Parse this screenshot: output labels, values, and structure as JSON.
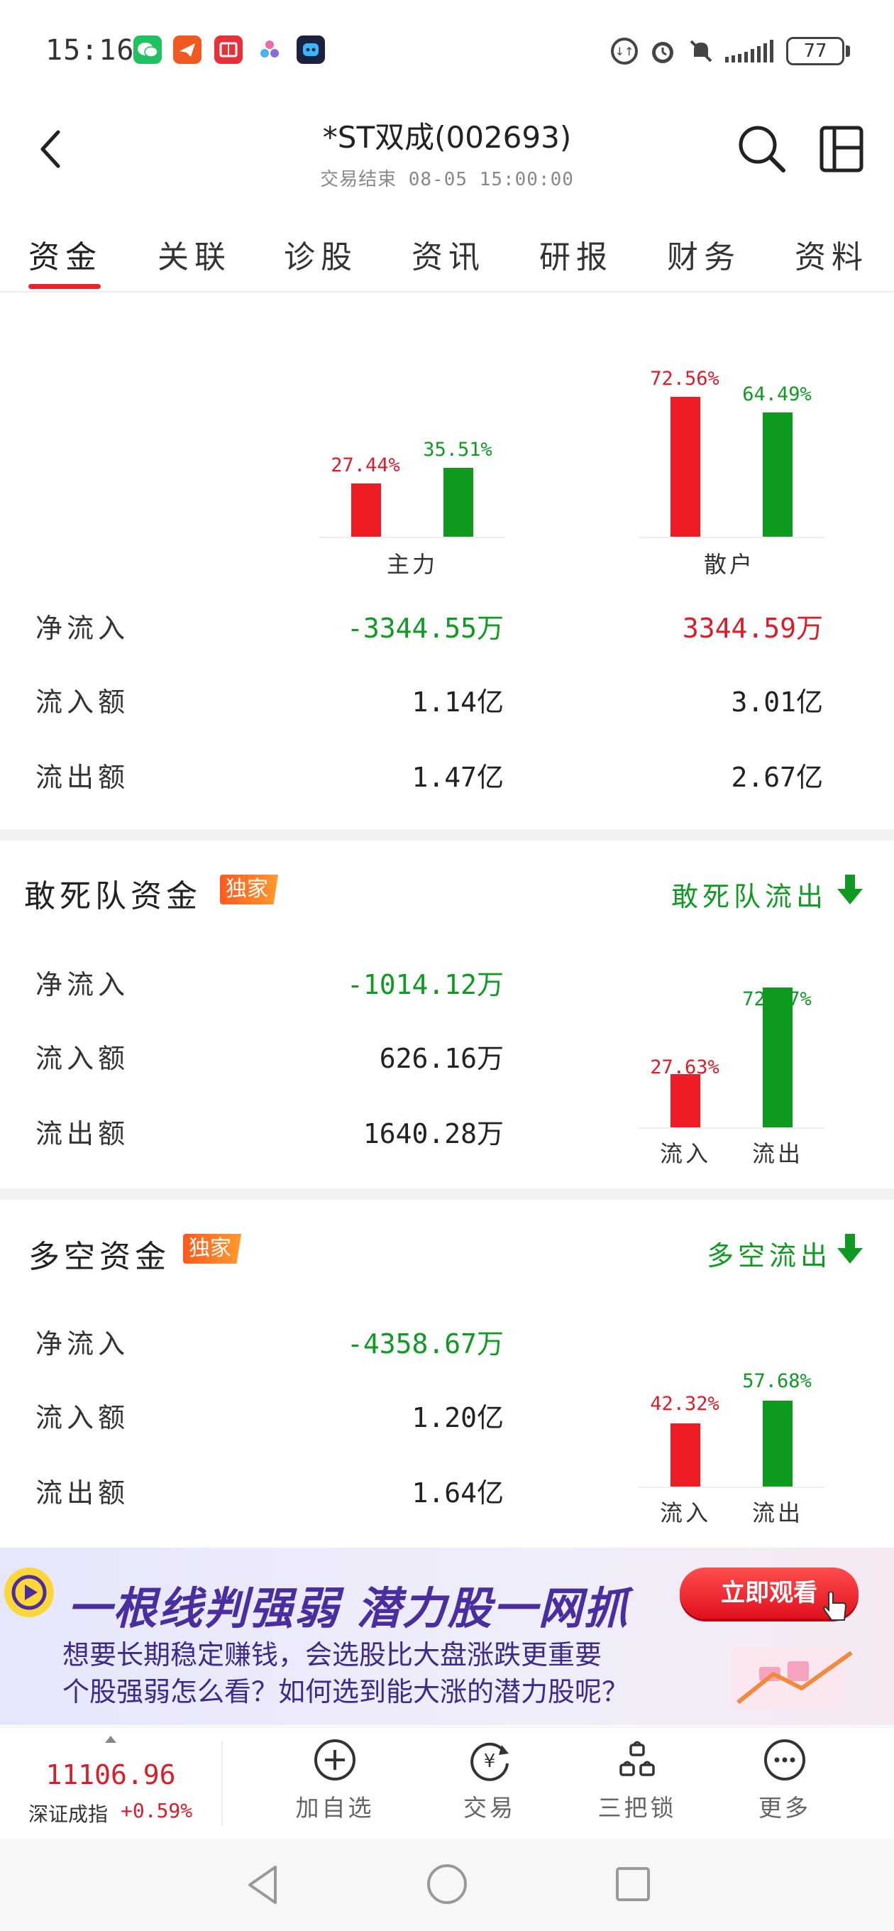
{
  "status_bar": {
    "time": "15:16",
    "battery": "77",
    "apps": [
      "wechat-icon",
      "telegram-like-icon",
      "reader-icon",
      "molecule-icon",
      "robot-icon"
    ],
    "system_icons": [
      "data-saver-icon",
      "alarm-icon",
      "mute-icon",
      "signal-icon"
    ]
  },
  "header": {
    "title": "*ST双成(002693)",
    "subtitle": "交易结束 08-05 15:00:00",
    "back_icon": "back-arrow-icon",
    "search_icon": "search-icon",
    "layout_icon": "layout-icon"
  },
  "tabs": [
    {
      "label": "资金",
      "active": true
    },
    {
      "label": "关联"
    },
    {
      "label": "诊股"
    },
    {
      "label": "资讯"
    },
    {
      "label": "研报"
    },
    {
      "label": "财务"
    },
    {
      "label": "资料"
    }
  ],
  "overview": {
    "groups": [
      {
        "name": "主力",
        "inflow_pct": "27.44%",
        "outflow_pct": "35.51%",
        "inflow_value": 27.44,
        "outflow_value": 35.51
      },
      {
        "name": "散户",
        "inflow_pct": "72.56%",
        "outflow_pct": "64.49%",
        "inflow_value": 72.56,
        "outflow_value": 64.49
      }
    ],
    "rows": [
      {
        "label": "净流入",
        "main": "-3344.55万",
        "retail": "3344.59万"
      },
      {
        "label": "流入额",
        "main": "1.14亿",
        "retail": "3.01亿"
      },
      {
        "label": "流出额",
        "main": "1.47亿",
        "retail": "2.67亿"
      }
    ]
  },
  "dare_to_die": {
    "title": "敢死队资金",
    "badge": "独家",
    "link": "敢死队流出",
    "rows": [
      {
        "label": "净流入",
        "value": "-1014.12万"
      },
      {
        "label": "流入额",
        "value": "626.16万"
      },
      {
        "label": "流出额",
        "value": "1640.28万"
      }
    ],
    "inflow_pct": "27.63%",
    "outflow_pct": "72.37%",
    "inflow_value": 27.63,
    "outflow_value": 72.37,
    "axis_in": "流入",
    "axis_out": "流出"
  },
  "long_short": {
    "title": "多空资金",
    "badge": "独家",
    "link": "多空流出",
    "rows": [
      {
        "label": "净流入",
        "value": "-4358.67万"
      },
      {
        "label": "流入额",
        "value": "1.20亿"
      },
      {
        "label": "流出额",
        "value": "1.64亿"
      }
    ],
    "inflow_pct": "42.32%",
    "outflow_pct": "57.68%",
    "inflow_value": 42.32,
    "outflow_value": 57.68,
    "axis_in": "流入",
    "axis_out": "流出"
  },
  "banner": {
    "headline": "一根线判强弱 潜力股一网抓",
    "line1": "想要长期稳定赚钱，会选股比大盘涨跌更重要",
    "line2": "个股强弱怎么看？如何选到能大涨的潜力股呢？",
    "button": "立即观看"
  },
  "toolbar": {
    "index_value": "11106.96",
    "index_name": "深证成指",
    "index_change": "+0.59%",
    "items": [
      {
        "label": "加自选",
        "icon": "plus-circle-icon"
      },
      {
        "label": "交易",
        "icon": "yuan-circle-icon"
      },
      {
        "label": "三把锁",
        "icon": "three-locks-icon"
      },
      {
        "label": "更多",
        "icon": "more-dots-icon"
      }
    ]
  },
  "colors": {
    "red": "#ee1d23",
    "green": "#0e9a1c",
    "accent": "#e8242c"
  }
}
